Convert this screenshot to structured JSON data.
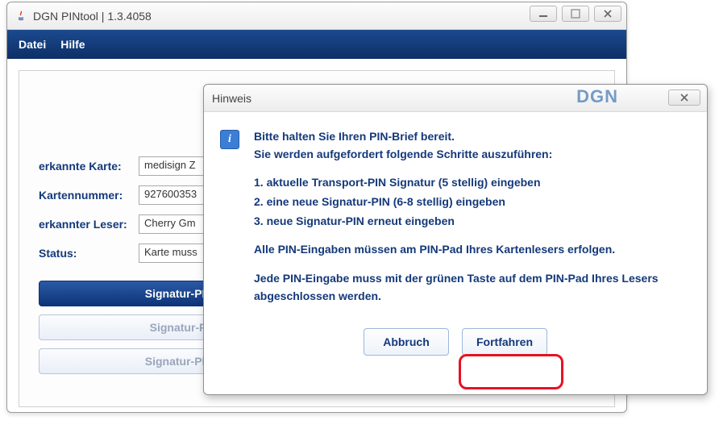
{
  "window": {
    "title": "DGN PINtool | 1.3.4058"
  },
  "menu": {
    "file": "Datei",
    "help": "Hilfe"
  },
  "fields": {
    "card_label": "erkannte Karte:",
    "card_value": "medisign Z",
    "number_label": "Kartennummer:",
    "number_value": "927600353",
    "reader_label": "erkannter Leser:",
    "reader_value": "Cherry Gm",
    "status_label": "Status:",
    "status_value": "Karte muss"
  },
  "actions": {
    "primary": "Signatur-PIN a",
    "secondary1": "Signatur-PIN",
    "secondary2": "Signatur-PIN e"
  },
  "dialog": {
    "title": "Hinweis",
    "logo": "DGN",
    "line1": "Bitte halten Sie Ihren PIN-Brief bereit.",
    "line2": "Sie werden aufgefordert folgende Schritte auszuführen:",
    "step1": "1. aktuelle Transport-PIN Signatur (5 stellig) eingeben",
    "step2": "2. eine neue Signatur-PIN (6-8 stellig) eingeben",
    "step3": "3. neue Signatur-PIN erneut eingeben",
    "note1": "Alle PIN-Eingaben müssen am PIN-Pad Ihres Kartenlesers erfolgen.",
    "note2": "Jede PIN-Eingabe muss mit der grünen Taste auf dem PIN-Pad Ihres Lesers abgeschlossen werden.",
    "cancel": "Abbruch",
    "continue": "Fortfahren"
  }
}
